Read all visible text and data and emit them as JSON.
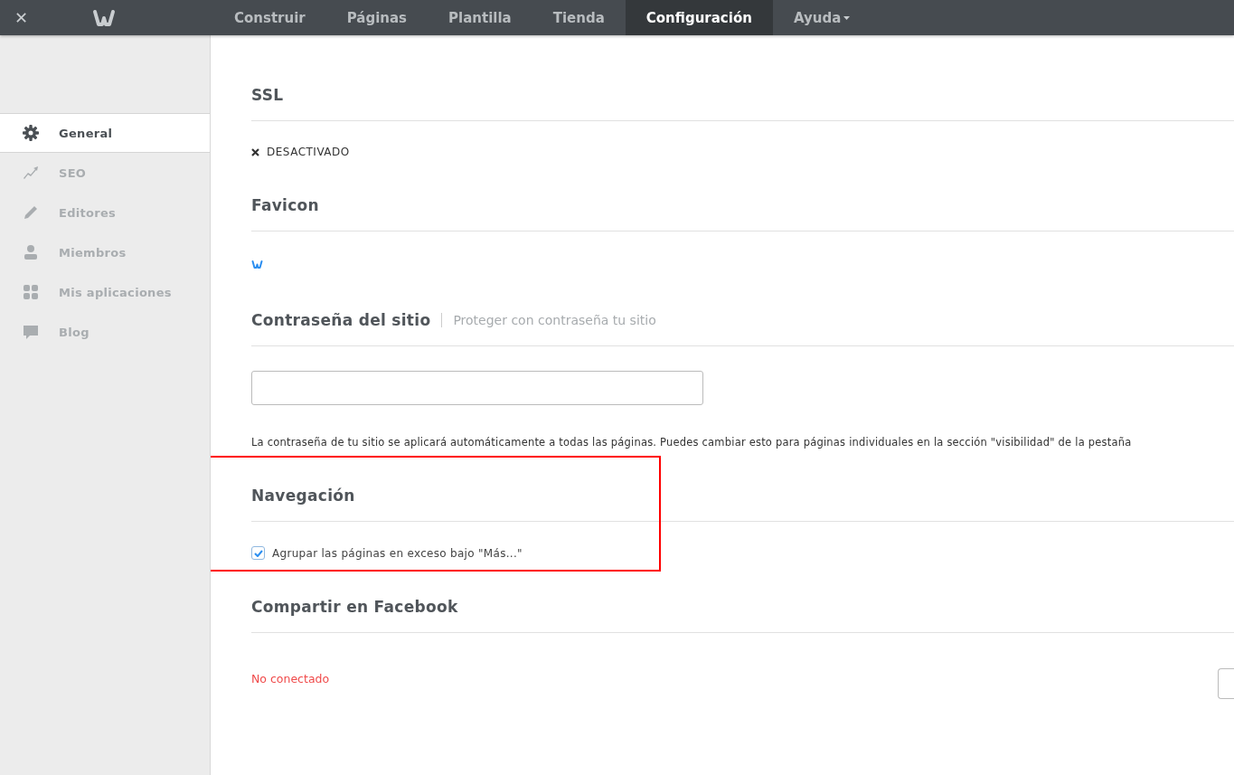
{
  "topbar": {
    "close": "✕",
    "tabs": [
      {
        "label": "Construir",
        "selected": false,
        "dropdown": false
      },
      {
        "label": "Páginas",
        "selected": false,
        "dropdown": false
      },
      {
        "label": "Plantilla",
        "selected": false,
        "dropdown": false
      },
      {
        "label": "Tienda",
        "selected": false,
        "dropdown": false
      },
      {
        "label": "Configuración",
        "selected": true,
        "dropdown": false
      },
      {
        "label": "Ayuda",
        "selected": false,
        "dropdown": true
      }
    ]
  },
  "sidebar": {
    "items": [
      {
        "label": "General",
        "selected": true
      },
      {
        "label": "SEO",
        "selected": false
      },
      {
        "label": "Editores",
        "selected": false
      },
      {
        "label": "Miembros",
        "selected": false
      },
      {
        "label": "Mis aplicaciones",
        "selected": false
      },
      {
        "label": "Blog",
        "selected": false
      }
    ]
  },
  "sections": [
    {
      "kind": "status",
      "title": "SSL",
      "status": "DESACTIVADO"
    },
    {
      "kind": "favicon",
      "title": "Favicon"
    },
    {
      "kind": "password",
      "title": "Contraseña del sitio",
      "subtitle": "Proteger con contraseña tu sitio",
      "help": "La contraseña de tu sitio se aplicará automáticamente a todas las páginas. Puedes cambiar esto para páginas individuales en la sección \"visibilidad\" de la pestaña"
    },
    {
      "kind": "checkbox",
      "title": "Navegación",
      "highlighted": true,
      "label": "Agrupar las páginas en exceso bajo \"Más...\"",
      "checked": true
    },
    {
      "kind": "connection",
      "title": "Compartir en Facebook",
      "status": "No conectado",
      "connected": false
    }
  ]
}
